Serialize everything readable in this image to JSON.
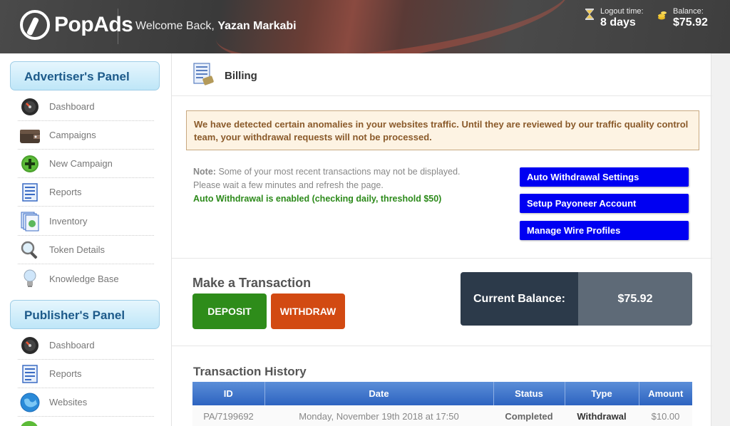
{
  "header": {
    "brand": "PopAds",
    "welcome_prefix": "Welcome Back,",
    "user_name": "Yazan Markabi",
    "logout_label": "Logout time:",
    "logout_value": "8 days",
    "balance_label": "Balance:",
    "balance_value": "$75.92",
    "icons": {
      "logout": "hourglass-icon",
      "balance": "coins-icon"
    }
  },
  "sidebar": {
    "advertiser_title": "Advertiser's Panel",
    "advertiser_items": [
      {
        "label": "Dashboard",
        "icon": "dashboard-icon"
      },
      {
        "label": "Campaigns",
        "icon": "wallet-icon"
      },
      {
        "label": "New Campaign",
        "icon": "plus-circle-icon"
      },
      {
        "label": "Reports",
        "icon": "report-icon"
      },
      {
        "label": "Inventory",
        "icon": "inventory-icon"
      },
      {
        "label": "Token Details",
        "icon": "magnifier-icon"
      },
      {
        "label": "Knowledge Base",
        "icon": "lightbulb-icon"
      }
    ],
    "publisher_title": "Publisher's Panel",
    "publisher_items": [
      {
        "label": "Dashboard",
        "icon": "dashboard-icon"
      },
      {
        "label": "Reports",
        "icon": "report-icon"
      },
      {
        "label": "Websites",
        "icon": "globe-icon"
      }
    ]
  },
  "page": {
    "title": "Billing",
    "alert": "We have detected certain anomalies in your websites traffic. Until they are reviewed by our traffic quality control team, your withdrawal requests will not be processed.",
    "note_label": "Note:",
    "note_line1": "Some of your most recent transactions may not be displayed.",
    "note_line2": "Please wait a few minutes and refresh the page.",
    "auto_withdrawal_status": "Auto Withdrawal is enabled (checking daily, threshold $50)",
    "buttons": {
      "auto_withdrawal": "Auto Withdrawal Settings",
      "payoneer": "Setup Payoneer Account",
      "wire": "Manage Wire Profiles"
    },
    "make_transaction_title": "Make a Transaction",
    "deposit_label": "DEPOSIT",
    "withdraw_label": "WITHDRAW",
    "current_balance_label": "Current Balance:",
    "current_balance_value": "$75.92",
    "history_title": "Transaction History",
    "history_columns": [
      "ID",
      "Date",
      "Status",
      "Type",
      "Amount"
    ],
    "history_rows": [
      {
        "id": "PA/7199692",
        "date": "Monday, November 19th 2018 at 17:50",
        "status": "Completed",
        "type": "Withdrawal",
        "amount": "$10.00"
      }
    ]
  },
  "colors": {
    "accent_blue": "#0000f2",
    "deposit_green": "#2e8c1a",
    "withdraw_orange": "#d24a12",
    "balance_dark": "#2c3a4a"
  }
}
